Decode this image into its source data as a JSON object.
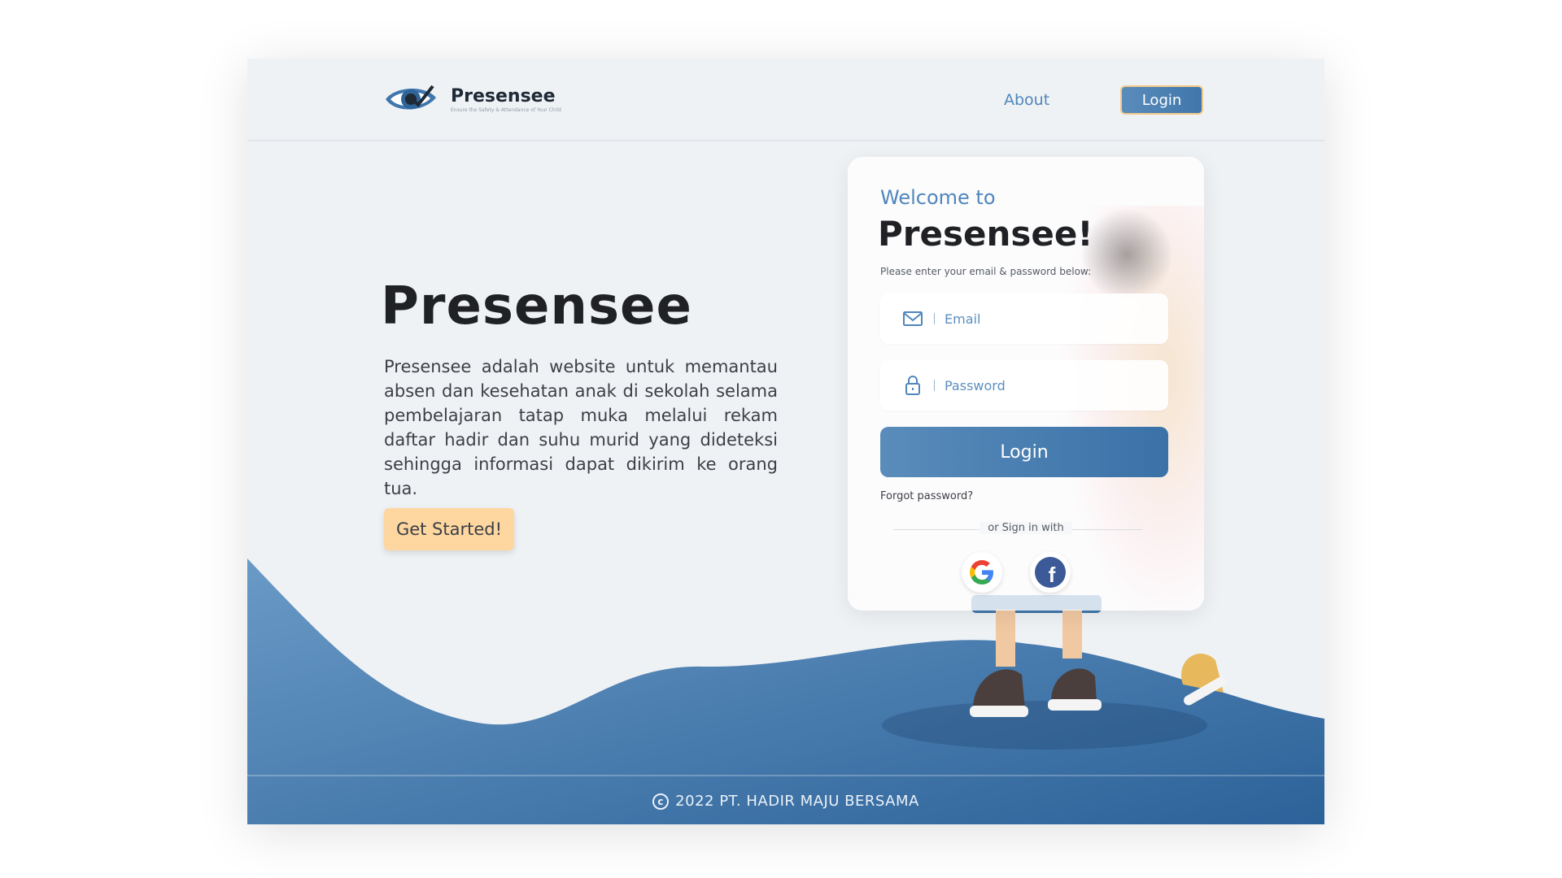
{
  "nav": {
    "brand": "Presensee",
    "tagline": "Ensure the Safety & Attendance of Your Child",
    "about": "About",
    "login": "Login"
  },
  "hero": {
    "title": "Presensee",
    "description": "Presensee adalah website untuk memantau absen dan kesehatan anak di sekolah selama pembelajaran tatap muka melalui rekam daftar hadir dan suhu murid yang dideteksi sehingga informasi dapat dikirim ke orang tua.",
    "cta": "Get Started!"
  },
  "login_card": {
    "welcome": "Welcome to",
    "title": "Presensee!",
    "subtitle": "Please enter your email & password below:",
    "email_placeholder": "Email",
    "password_placeholder": "Password",
    "login_button": "Login",
    "forgot": "Forgot password?",
    "or_sign_in": "or Sign in with",
    "social": [
      "google-icon",
      "facebook-icon"
    ]
  },
  "footer": {
    "text": "2022 PT. HADIR MAJU BERSAMA"
  },
  "colors": {
    "primary": "#4f86bb",
    "primary_dark": "#2f6499",
    "accent": "#fed7a0",
    "background": "#eff2f5"
  }
}
